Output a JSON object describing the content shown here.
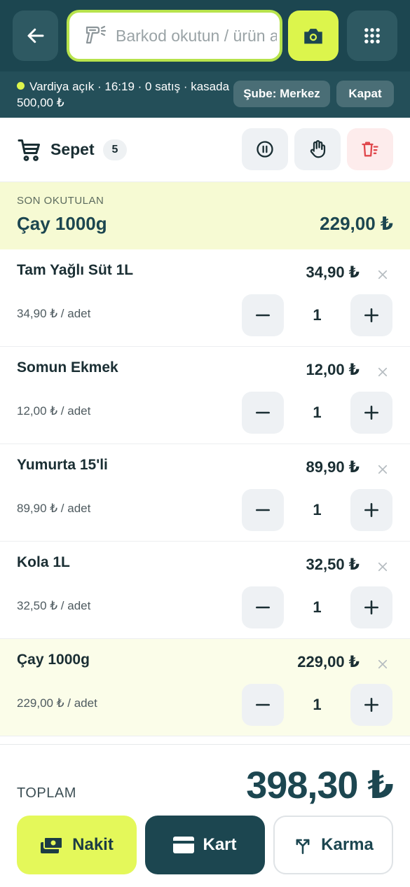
{
  "topbar": {
    "search_placeholder": "Barkod okutun / ürün ara",
    "icons": {
      "back": "arrow-left-icon",
      "scanner": "barcode-scanner-icon",
      "camera": "camera-icon",
      "menu": "grid-dots-icon"
    }
  },
  "shift": {
    "line1": "Vardiya açık · 16:19 · 0 satış · kasada",
    "line2": "500,00 ₺",
    "branch_label": "Şube: Merkez",
    "close_label": "Kapat",
    "status_color": "#dcf54c"
  },
  "basket": {
    "title": "Sepet",
    "count": "5"
  },
  "last_scanned": {
    "label": "SON OKUTULAN",
    "name": "Çay 1000g",
    "price": "229,00 ₺"
  },
  "items": [
    {
      "name": "Tam Yağlı Süt 1L",
      "price": "34,90 ₺",
      "unit_price": "34,90 ₺ / adet",
      "qty": "1"
    },
    {
      "name": "Somun Ekmek",
      "price": "12,00 ₺",
      "unit_price": "12,00 ₺ / adet",
      "qty": "1"
    },
    {
      "name": "Yumurta 15'li",
      "price": "89,90 ₺",
      "unit_price": "89,90 ₺ / adet",
      "qty": "1"
    },
    {
      "name": "Kola 1L",
      "price": "32,50 ₺",
      "unit_price": "32,50 ₺ / adet",
      "qty": "1"
    },
    {
      "name": "Çay 1000g",
      "price": "229,00 ₺",
      "unit_price": "229,00 ₺ / adet",
      "qty": "1"
    }
  ],
  "footer": {
    "total_label": "TOPLAM",
    "total_value": "398,30 ₺",
    "cash_label": "Nakit",
    "card_label": "Kart",
    "mixed_label": "Karma"
  },
  "colors": {
    "primary": "#1c4650",
    "accent": "#dcf54c",
    "danger": "#e0474c"
  }
}
